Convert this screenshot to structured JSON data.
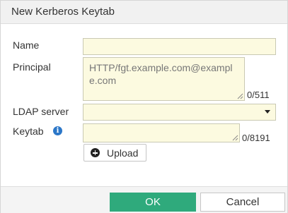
{
  "dialog": {
    "title": "New Kerberos Keytab"
  },
  "form": {
    "name": {
      "label": "Name",
      "value": ""
    },
    "principal": {
      "label": "Principal",
      "placeholder": "HTTP/fgt.example.com@example.com",
      "counter": "0/511"
    },
    "ldap_server": {
      "label": "LDAP server",
      "selected": ""
    },
    "keytab": {
      "label": "Keytab",
      "value": "",
      "counter": "0/8191",
      "upload_label": "Upload"
    }
  },
  "footer": {
    "ok_label": "OK",
    "cancel_label": "Cancel"
  },
  "colors": {
    "field_bg": "#fcfae0",
    "ok_bg": "#2faa7c",
    "info_icon": "#2c77c8"
  },
  "icons": {
    "info": "info-icon",
    "upload": "plus-circle-icon",
    "dropdown": "caret-down-icon",
    "resize": "resize-handle-icon"
  }
}
